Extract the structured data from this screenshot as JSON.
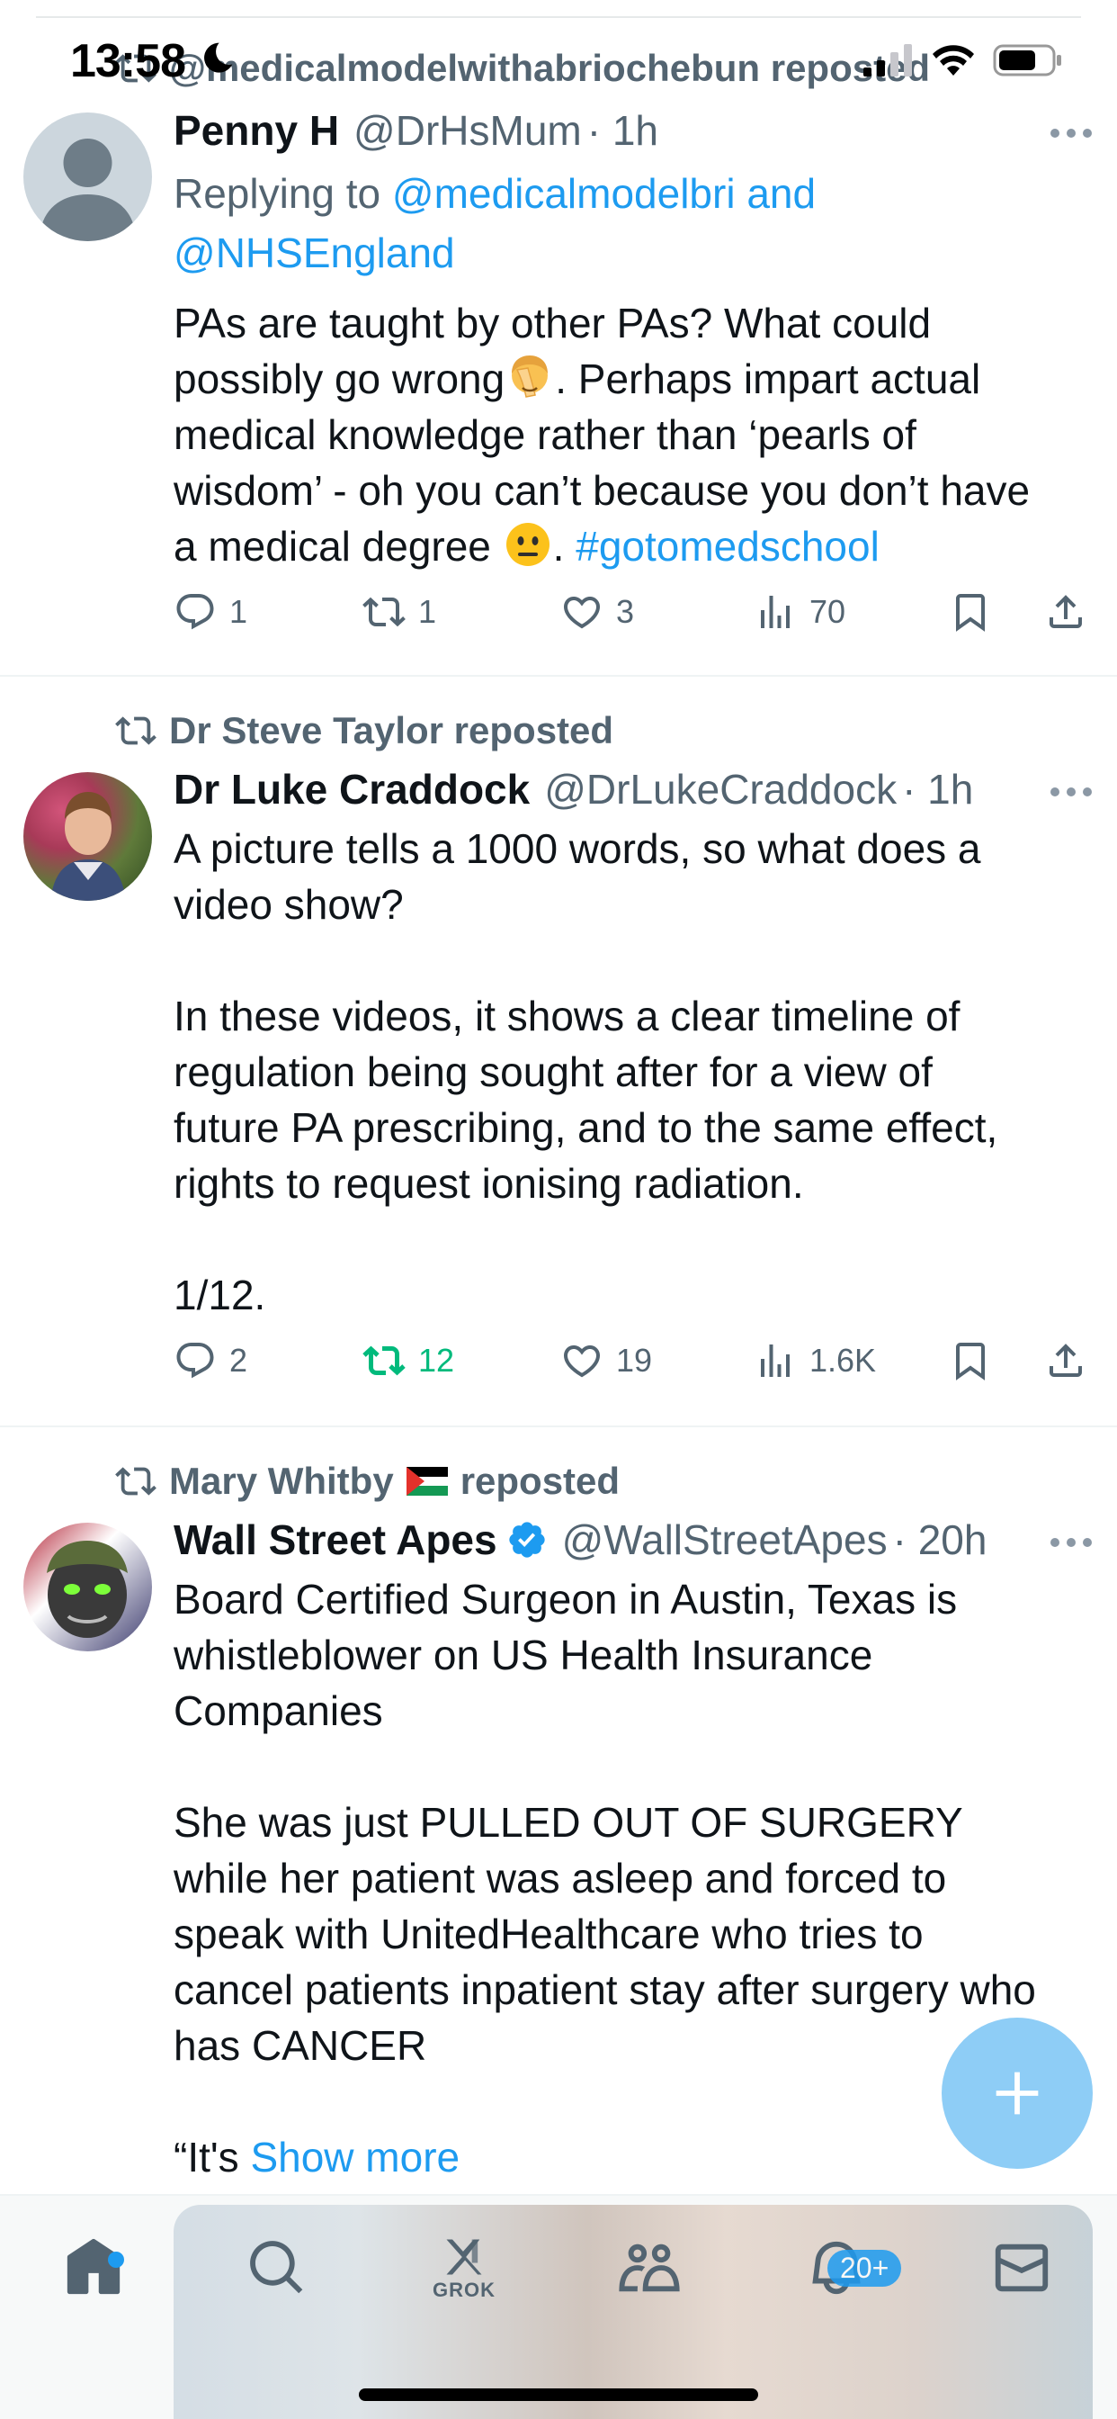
{
  "status_bar": {
    "time": "13:58"
  },
  "tweets": [
    {
      "repost_by": "@medicalmodelwithabriochebun reposted",
      "name": "Penny H",
      "handle": "@DrHsMum",
      "time": "· 1h",
      "replying_prefix": "Replying to ",
      "replying_handles": "@medicalmodelbri and",
      "replying_handles2": "@NHSEngland",
      "text_lines": [
        "PAs are taught by other PAs? What could",
        "possibly go wrong",
        ". Perhaps impart actual",
        "medical knowledge rather than ‘pearls of",
        "wisdom’ - oh you can’t because you don’t have",
        "a medical degree ",
        ". ",
        "#gotomedschool"
      ],
      "emoji_1": "face-palm-emoji",
      "emoji_2": "neutral-face-emoji",
      "replies": "1",
      "reposts": "1",
      "likes": "3",
      "views": "70"
    },
    {
      "repost_by": "Dr Steve Taylor reposted",
      "name": "Dr Luke Craddock",
      "handle": "@DrLukeCraddock",
      "time": "· 1h",
      "text_lines": [
        "A picture tells a 1000 words, so what does a",
        "video show?",
        "In these videos, it shows a clear timeline of",
        "regulation being sought after for a view of",
        "future PA prescribing, and to the same effect,",
        "rights to request ionising radiation.",
        "1/12."
      ],
      "replies": "2",
      "reposts": "12",
      "likes": "19",
      "views": "1.6K"
    },
    {
      "repost_by_name": "Mary Whitby",
      "repost_by_suffix": "reposted",
      "name": "Wall Street Apes",
      "handle": "@WallStreetApes",
      "time": "· 20h",
      "text_lines": [
        "Board Certified Surgeon in Austin, Texas is",
        "whistleblower on US Health Insurance",
        "Companies",
        "She was just PULLED OUT OF SURGERY",
        "while her patient was asleep and forced to",
        "speak with UnitedHealthcare who tries to",
        "cancel patients inpatient stay after surgery who",
        "has CANCER",
        "“It's ",
        "Show more"
      ]
    }
  ],
  "bottom_nav": {
    "grok_label": "GROK",
    "notifications_badge": "20+"
  },
  "colors": {
    "link": "#1d9bf0",
    "secondary": "#536471",
    "repost_active": "#00ba7c",
    "verified": "#1d9bf0",
    "fab": "#8ecdf6"
  }
}
